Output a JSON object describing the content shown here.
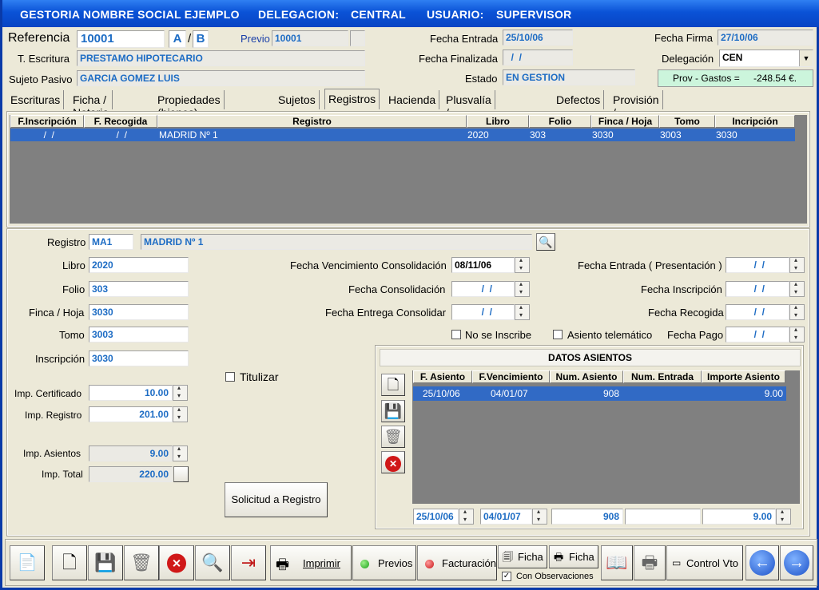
{
  "title": {
    "app": "GESTORIA NOMBRE SOCIAL EJEMPLO",
    "deleg_label": "DELEGACION:",
    "deleg_value": "CENTRAL",
    "user_label": "USUARIO:",
    "user_value": "SUPERVISOR"
  },
  "header": {
    "referencia_label": "Referencia",
    "referencia": "10001",
    "btn_a": "A",
    "sep": "/",
    "btn_b": "B",
    "previo_label": "Previo",
    "previo": "10001",
    "escritura_label": "T. Escritura",
    "escritura": "PRESTAMO HIPOTECARIO",
    "sujeto_label": "Sujeto Pasivo",
    "sujeto": "GARCIA GOMEZ LUIS",
    "fentrada_label": "Fecha Entrada",
    "fentrada": "25/10/06",
    "ffinal_label": "Fecha Finalizada",
    "ffinal": "  /  /",
    "estado_label": "Estado",
    "estado": "EN GESTION",
    "ffirma_label": "Fecha Firma",
    "ffirma": "27/10/06",
    "delegacion_label": "Delegación",
    "delegacion": "CEN",
    "prov_label": "Prov - Gastos =",
    "prov_value": "-248.54 €."
  },
  "tabs": [
    "Escrituras",
    "Ficha / Notaria",
    "Propiedades (bienes)",
    "Sujetos",
    "Registros",
    "Hacienda",
    "Plusvalía / Catastro",
    "Defectos",
    "Provisión / Facturas"
  ],
  "grid": {
    "headers": [
      "F.Inscripción",
      "F. Recogida",
      "Registro",
      "Libro",
      "Folio",
      "Finca / Hoja",
      "Tomo",
      "Incripción"
    ],
    "row": [
      "  /  /",
      "  /  /",
      "MADRID Nº 1",
      "2020",
      "303",
      "3030",
      "3003",
      "3030"
    ]
  },
  "form": {
    "registro_label": "Registro",
    "registro_code": "MA1",
    "registro_name": "MADRID Nº 1",
    "libro_label": "Libro",
    "libro": "2020",
    "folio_label": "Folio",
    "folio": "303",
    "finca_label": "Finca / Hoja",
    "finca": "3030",
    "tomo_label": "Tomo",
    "tomo": "3003",
    "inscripcion_label": "Inscripción",
    "inscripcion": "3030",
    "fvc_label": "Fecha Vencimiento Consolidación",
    "fvc": "08/11/06",
    "fc_label": "Fecha Consolidación",
    "fc": "  /  /",
    "fec_label": "Fecha Entrega Consolidar",
    "fec": "  /  /",
    "fep_label": "Fecha Entrada ( Presentación )",
    "fep": "  /  /",
    "fi_label": "Fecha Inscripción",
    "fi": "  /  /",
    "fr_label": "Fecha Recogida",
    "fr": "  /  /",
    "fp_label": "Fecha Pago",
    "fp": "  /  /",
    "noinscribe_label": "No se Inscribe",
    "telematico_label": "Asiento telemático",
    "titulizar_label": "Titulizar",
    "impcert_label": "Imp. Certificado",
    "impcert": "10.00",
    "impreg_label": "Imp. Registro",
    "impreg": "201.00",
    "impas_label": "Imp. Asientos",
    "impas": "9.00",
    "imptot_label": "Imp. Total",
    "imptot": "220.00",
    "solicitud_label": "Solicitud a Registro"
  },
  "asientos": {
    "title": "DATOS ASIENTOS",
    "headers": [
      "F. Asiento",
      "F.Vencimiento",
      "Num. Asiento",
      "Num. Entrada",
      "Importe Asiento"
    ],
    "row": [
      "25/10/06",
      "04/01/07",
      "908",
      "",
      "9.00"
    ],
    "edit": {
      "fasiento": "25/10/06",
      "fvenc": "04/01/07",
      "num": "908",
      "entrada": "",
      "importe": "9.00"
    }
  },
  "toolbar": {
    "imprimir": "Imprimir",
    "previos": "Previos",
    "facturacion": "Facturación",
    "ficha1": "Ficha",
    "ficha2": "Ficha",
    "obs": "Con Observaciones",
    "control": "Control Vto"
  },
  "colors": {
    "title": "#0a52d6",
    "selected_row": "#316ac5",
    "value_text": "#1d6cc4"
  }
}
